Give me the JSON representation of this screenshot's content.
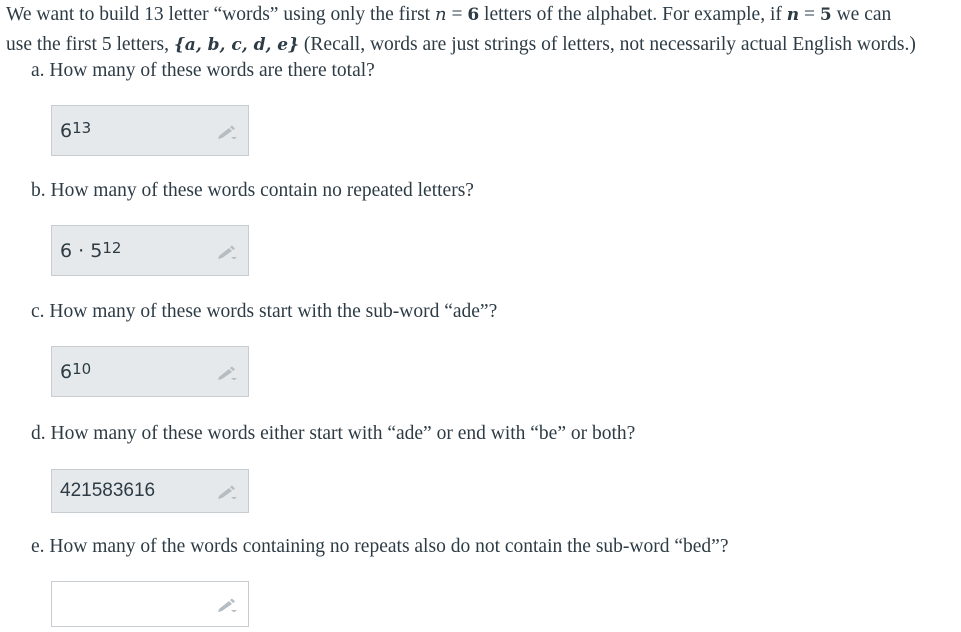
{
  "intro": {
    "line1_a": "We want to build 13 letter “words” using only the first ",
    "line1_n": "n",
    "line1_eq1": " = ",
    "line1_six": "6",
    "line1_b": " letters of the alphabet. For example, if ",
    "line1_n2": "n",
    "line1_eq2": " = ",
    "line1_five": "5",
    "line1_c": " we can",
    "line2_a": "use the first 5 letters, ",
    "line2_set": "{a, b, c, d, e}",
    "line2_b": " (Recall, words are just strings of letters, not necessarily actual English words.)"
  },
  "questions": [
    {
      "label": "a. How many of these words are there total?",
      "answer_base": "6",
      "answer_exp": "13",
      "answer_prefix": ""
    },
    {
      "label": "b. How many of these words contain no repeated letters?",
      "answer_prefix": "6 · ",
      "answer_base": "5",
      "answer_exp": "12"
    },
    {
      "label": "c. How many of these words start with the sub-word “ade”?",
      "answer_prefix": "",
      "answer_base": "6",
      "answer_exp": "10"
    },
    {
      "label": "d. How many of these words either start with “ade” or end with “be” or both?",
      "answer_text": "421583616"
    },
    {
      "label": "e. How many of the words containing no repeats also do not contain the sub-word “bed”?",
      "answer_text": ""
    }
  ],
  "icons": {
    "edit": "pencil-icon"
  },
  "colors": {
    "text": "#2d3b45",
    "answer_bg": "#e6e9eb",
    "answer_border": "#c7cdd1",
    "icon": "#b5bcc2"
  }
}
